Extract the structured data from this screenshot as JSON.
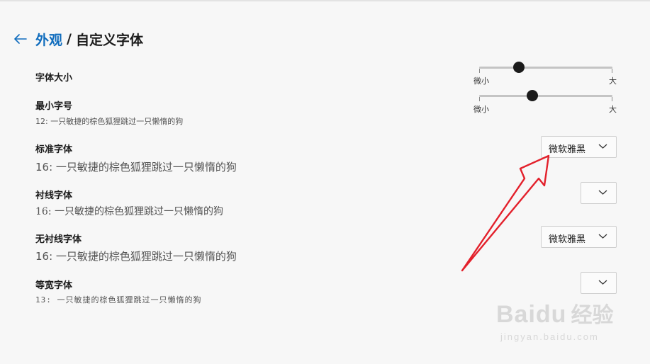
{
  "header": {
    "parent_link": "外观",
    "separator": "/",
    "title": "自定义字体"
  },
  "font_size": {
    "label": "字体大小",
    "slider": {
      "min_label": "微小",
      "max_label": "大",
      "value_fraction": 0.3
    }
  },
  "min_font_size": {
    "label": "最小字号",
    "sample": "12: 一只敏捷的棕色狐狸跳过一只懒惰的狗",
    "slider": {
      "min_label": "微小",
      "max_label": "大",
      "value_fraction": 0.4
    }
  },
  "standard_font": {
    "label": "标准字体",
    "sample": "16: 一只敏捷的棕色狐狸跳过一只懒惰的狗",
    "selected": "微软雅黑"
  },
  "serif_font": {
    "label": "衬线字体",
    "sample": "16: 一只敏捷的棕色狐狸跳过一只懒惰的狗",
    "selected": ""
  },
  "sans_serif_font": {
    "label": "无衬线字体",
    "sample": "16: 一只敏捷的棕色狐狸跳过一只懒惰的狗",
    "selected": "微软雅黑"
  },
  "monospace_font": {
    "label": "等宽字体",
    "sample": "13: 一只敏捷的棕色狐狸跳过一只懒惰的狗",
    "selected": ""
  },
  "watermark": {
    "logo": "Baidu",
    "logo_cn": "经验",
    "url": "jingyan.baidu.com"
  },
  "colors": {
    "accent": "#0f6cbd",
    "annotation_arrow": "#e3202b"
  }
}
